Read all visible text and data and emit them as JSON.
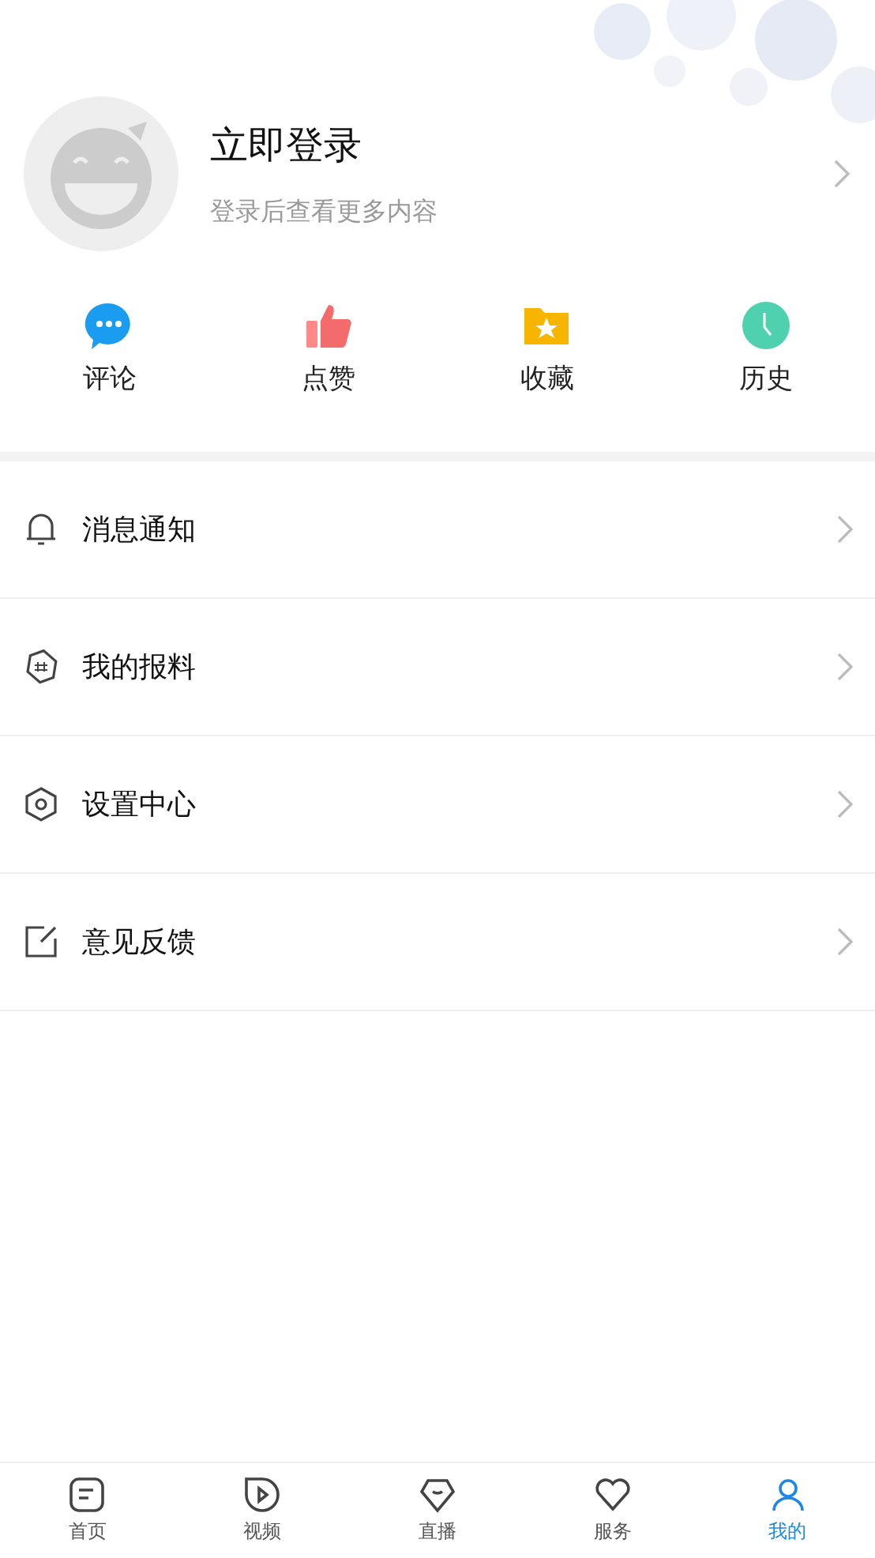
{
  "profile": {
    "title": "立即登录",
    "subtitle": "登录后查看更多内容"
  },
  "shortcuts": [
    {
      "label": "评论",
      "kind": "comment"
    },
    {
      "label": "点赞",
      "kind": "like"
    },
    {
      "label": "收藏",
      "kind": "favorite"
    },
    {
      "label": "历史",
      "kind": "history"
    }
  ],
  "menu": [
    {
      "label": "消息通知",
      "kind": "bell"
    },
    {
      "label": "我的报料",
      "kind": "tag"
    },
    {
      "label": "设置中心",
      "kind": "settings"
    },
    {
      "label": "意见反馈",
      "kind": "edit"
    }
  ],
  "tab_bar": [
    {
      "label": "首页",
      "kind": "home",
      "selected": false
    },
    {
      "label": "视频",
      "kind": "video",
      "selected": false
    },
    {
      "label": "直播",
      "kind": "live",
      "selected": false
    },
    {
      "label": "服务",
      "kind": "service",
      "selected": false
    },
    {
      "label": "我的",
      "kind": "me",
      "selected": true
    }
  ]
}
